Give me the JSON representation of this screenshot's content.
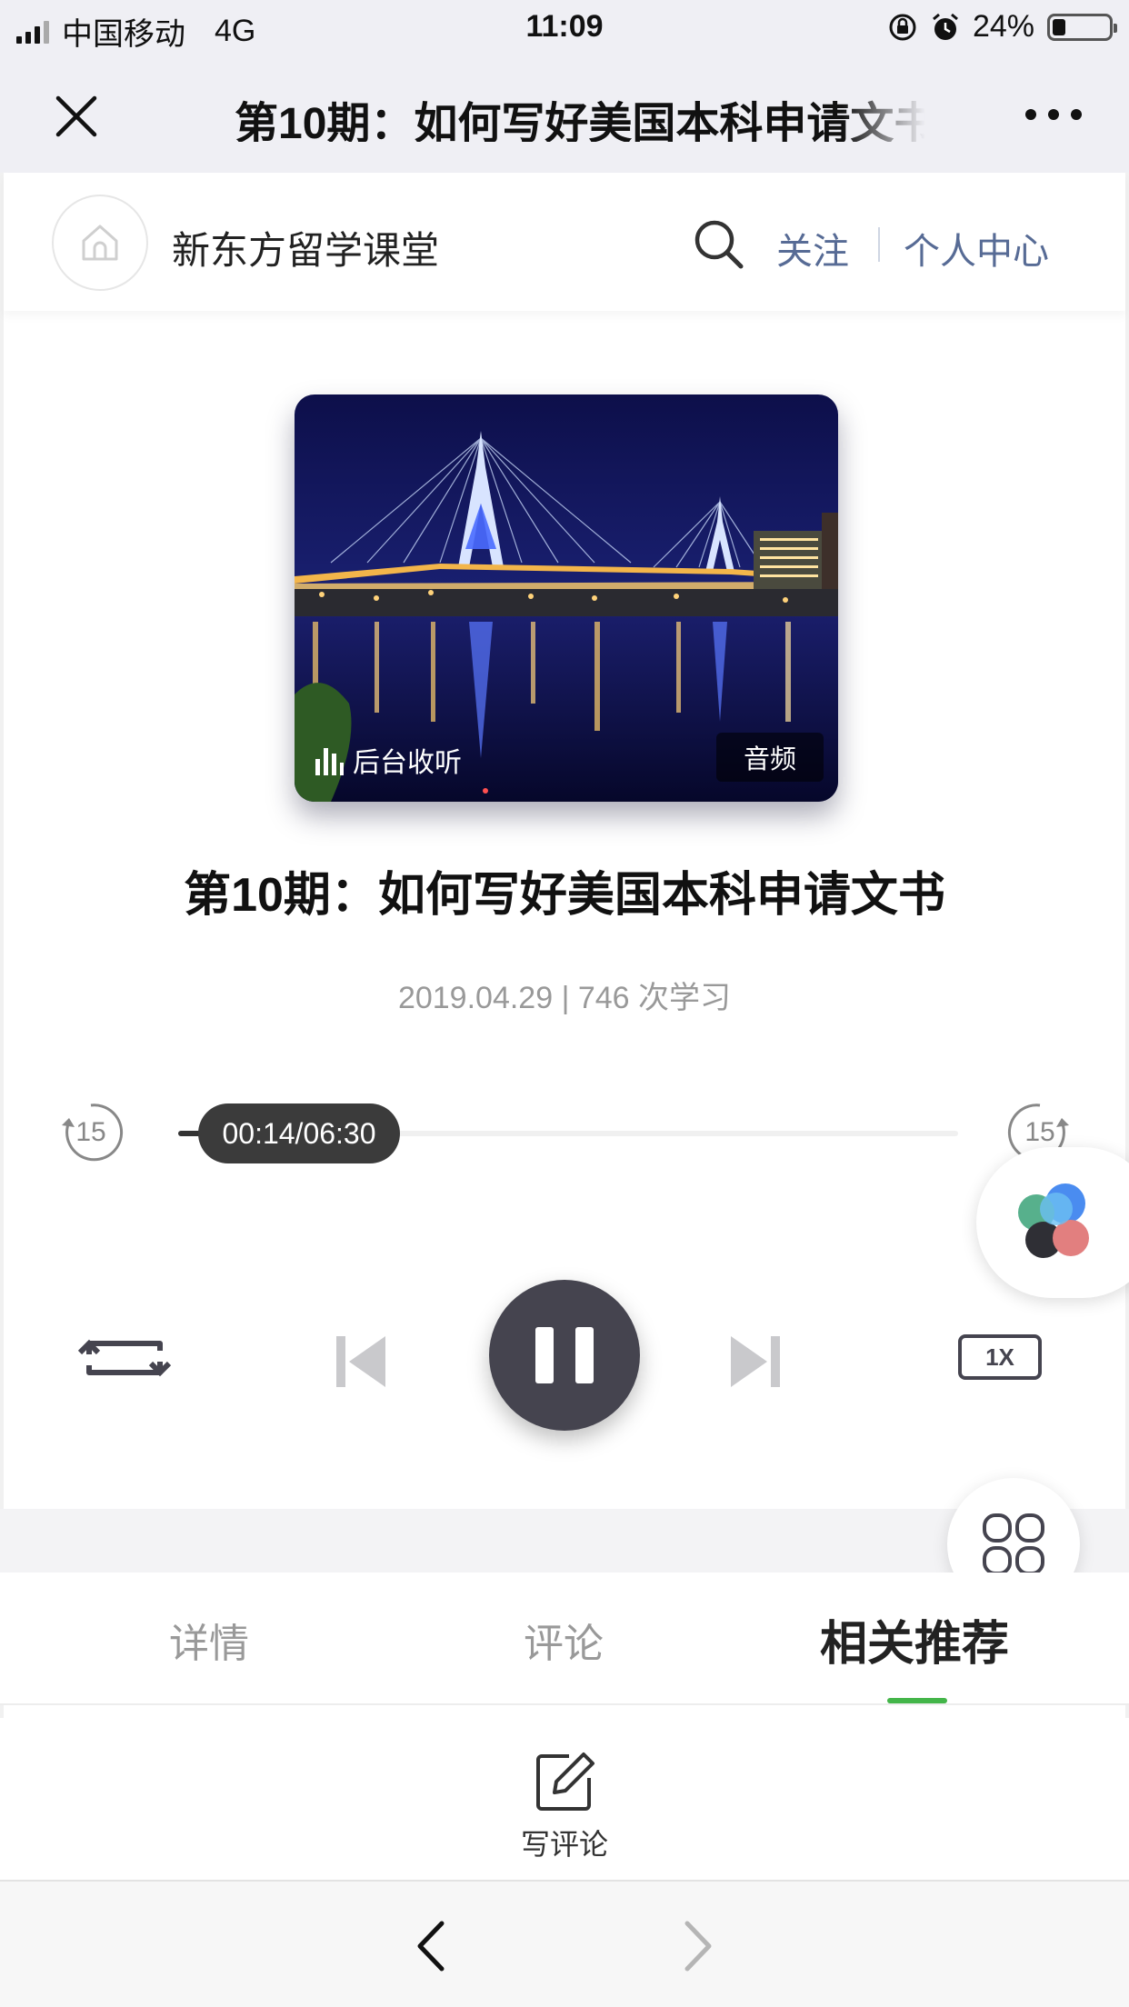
{
  "status_bar": {
    "carrier": "中国移动",
    "network": "4G",
    "time": "11:09",
    "battery": "24%",
    "battery_level": 0.24
  },
  "nav": {
    "title": "第10期：如何写好美国本科申请文书"
  },
  "channel": {
    "name": "新东方留学课堂",
    "follow": "关注",
    "profile": "个人中心"
  },
  "cover": {
    "background_listen": "后台收听",
    "type_tag": "音频"
  },
  "episode": {
    "title": "第10期：如何写好美国本科申请文书",
    "meta": "2019.04.29 | 746 次学习"
  },
  "player": {
    "time_display": "00:14/06:30",
    "progress": 0.036,
    "skip_back": "15",
    "skip_forward": "15",
    "speed": "1X"
  },
  "tabs": [
    {
      "label": "详情"
    },
    {
      "label": "评论"
    },
    {
      "label": "相关推荐"
    }
  ],
  "active_tab": "相关推荐",
  "comment": {
    "label": "写评论"
  },
  "colors": {
    "accent_green": "#43b549",
    "link_blue": "#576b95",
    "player_dark": "#45444f"
  }
}
